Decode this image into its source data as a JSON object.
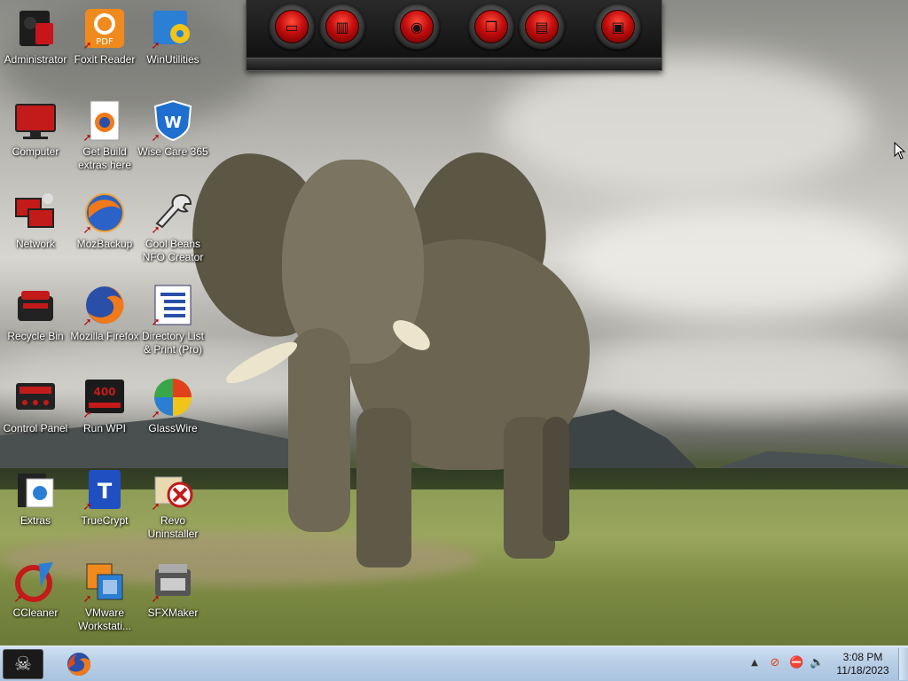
{
  "desktop": {
    "icons": [
      {
        "label": "Administrator",
        "icon": "user-folder-icon"
      },
      {
        "label": "Foxit Reader",
        "icon": "foxit-pdf-icon"
      },
      {
        "label": "WinUtilities",
        "icon": "winutilities-icon"
      },
      {
        "label": "Computer",
        "icon": "monitor-icon"
      },
      {
        "label": "Get Build extras here",
        "icon": "firefox-document-icon"
      },
      {
        "label": "Wise Care 365",
        "icon": "wise-care-shield-icon"
      },
      {
        "label": "Network",
        "icon": "network-icon"
      },
      {
        "label": "MozBackup",
        "icon": "mozbackup-icon"
      },
      {
        "label": "Cool Beans NFO Creator",
        "icon": "wrench-icon"
      },
      {
        "label": "Recycle Bin",
        "icon": "recycle-bin-icon"
      },
      {
        "label": "Mozilla Firefox",
        "icon": "firefox-icon"
      },
      {
        "label": "Directory List & Print (Pro)",
        "icon": "directory-list-icon"
      },
      {
        "label": "Control Panel",
        "icon": "control-panel-icon"
      },
      {
        "label": "Run WPI",
        "icon": "wpi-icon"
      },
      {
        "label": "GlassWire",
        "icon": "glasswire-icon"
      },
      {
        "label": "Extras",
        "icon": "extras-folder-icon"
      },
      {
        "label": "TrueCrypt",
        "icon": "truecrypt-icon"
      },
      {
        "label": "Revo Uninstaller",
        "icon": "revo-uninstaller-icon"
      },
      {
        "label": "CCleaner",
        "icon": "ccleaner-icon"
      },
      {
        "label": "VMware Workstati...",
        "icon": "vmware-icon"
      },
      {
        "label": "SFXMaker",
        "icon": "sfxmaker-icon"
      }
    ]
  },
  "dock": {
    "buttons": [
      "monitor-icon",
      "recycle-bin-icon",
      "disc-icon",
      "folder-stack-icon",
      "documents-icon",
      "package-icon"
    ]
  },
  "taskbar": {
    "start_icon": "pirate-flag-icon",
    "pinned": [
      "firefox-icon"
    ],
    "tray": [
      "show-hidden-icons-arrow",
      "network-status-icon",
      "blocked-icon",
      "volume-icon"
    ],
    "clock_time": "3:08 PM",
    "clock_date": "11/18/2023"
  },
  "colors": {
    "taskbar": "#b9cfe6",
    "dock_accent": "#c40d0d",
    "label_text": "#ffffff"
  }
}
